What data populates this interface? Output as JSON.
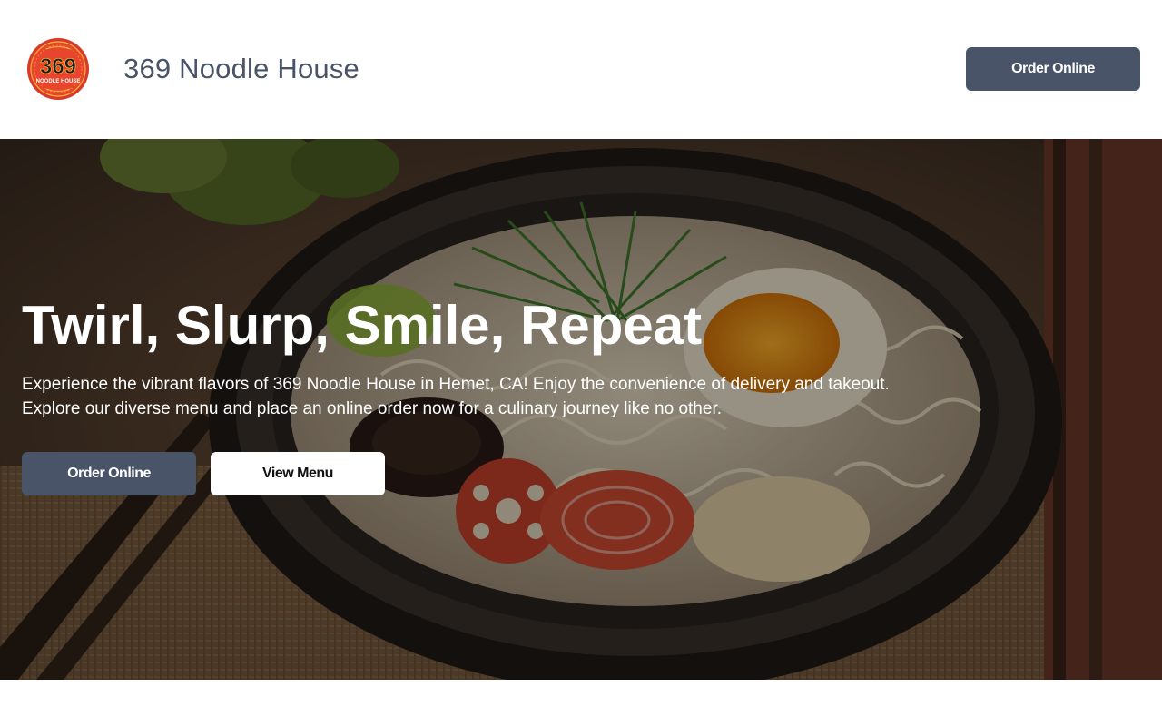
{
  "header": {
    "logo": {
      "number": "369",
      "sub": "NOODLE HOUSE",
      "colors": {
        "ring": "#d8392b",
        "face": "#e8452f",
        "text": "#1a1a1a",
        "gold": "#f2b233"
      }
    },
    "title": "369 Noodle House",
    "order_button": "Order Online"
  },
  "hero": {
    "title": "Twirl, Slurp, Smile, Repeat",
    "description": "Experience the vibrant flavors of 369 Noodle House in Hemet, CA! Enjoy the convenience of delivery and takeout. Explore our diverse menu and place an online order now for a culinary journey like no other.",
    "order_button": "Order Online",
    "menu_button": "View Menu",
    "image_subject": "ramen-bowl-photo"
  },
  "colors": {
    "primary_button": "#4a5468",
    "title_text": "#4a5468"
  }
}
